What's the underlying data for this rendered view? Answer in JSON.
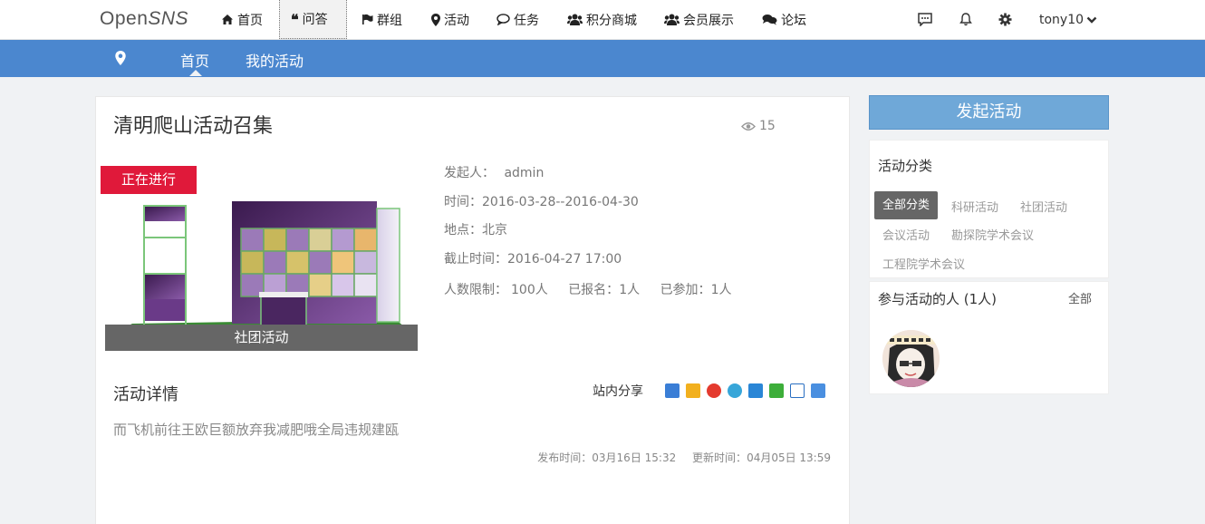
{
  "brand": {
    "logo_a": "Open",
    "logo_b": "SNS"
  },
  "nav": {
    "items": [
      {
        "label": "首页",
        "icon": "home-icon"
      },
      {
        "label": "问答",
        "icon": "quote-icon"
      },
      {
        "label": "群组",
        "icon": "flag-icon"
      },
      {
        "label": "活动",
        "icon": "map-marker-icon"
      },
      {
        "label": "任务",
        "icon": "comment-icon"
      },
      {
        "label": "积分商城",
        "icon": "users-icon"
      },
      {
        "label": "会员展示",
        "icon": "users-icon"
      },
      {
        "label": "论坛",
        "icon": "comments-icon"
      }
    ],
    "active_index": 1,
    "username": "tony10"
  },
  "subnav": {
    "items": [
      {
        "label": "首页"
      },
      {
        "label": "我的活动"
      }
    ],
    "active_index": 0
  },
  "event": {
    "title": "清明爬山活动召集",
    "views": "15",
    "status": "正在进行",
    "category_caption": "社团活动",
    "organizer_label": "发起人：",
    "organizer": "admin",
    "time_label": "时间：",
    "time": "2016-03-28--2016-04-30",
    "place_label": "地点：",
    "place": "北京",
    "deadline_label": "截止时间：",
    "deadline": "2016-04-27 17:00",
    "limit_label": "人数限制：",
    "limit": "100人",
    "signed_label": "已报名：",
    "signed": "1人",
    "joined_label": "已参加：",
    "joined": "1人",
    "detail_title": "活动详情",
    "share_label": "站内分享",
    "description": "而飞机前往王欧巨额放弃我减肥哦全局违规建瓯",
    "published_label": "发布时间：",
    "published": "03月16日 15:32",
    "updated_label": "更新时间：",
    "updated": "04月05日 13:59"
  },
  "sidebar": {
    "launch_label": "发起活动",
    "categories_title": "活动分类",
    "categories": [
      "全部分类",
      "科研活动",
      "社团活动",
      "会议活动",
      "勘探院学术会议",
      "工程院学术会议"
    ],
    "participants_title": "参与活动的人 (1人)",
    "participants_all": "全部"
  },
  "colors": {
    "accent": "#4b87cf",
    "status": "#e0193a",
    "button": "#6fa8d8"
  }
}
